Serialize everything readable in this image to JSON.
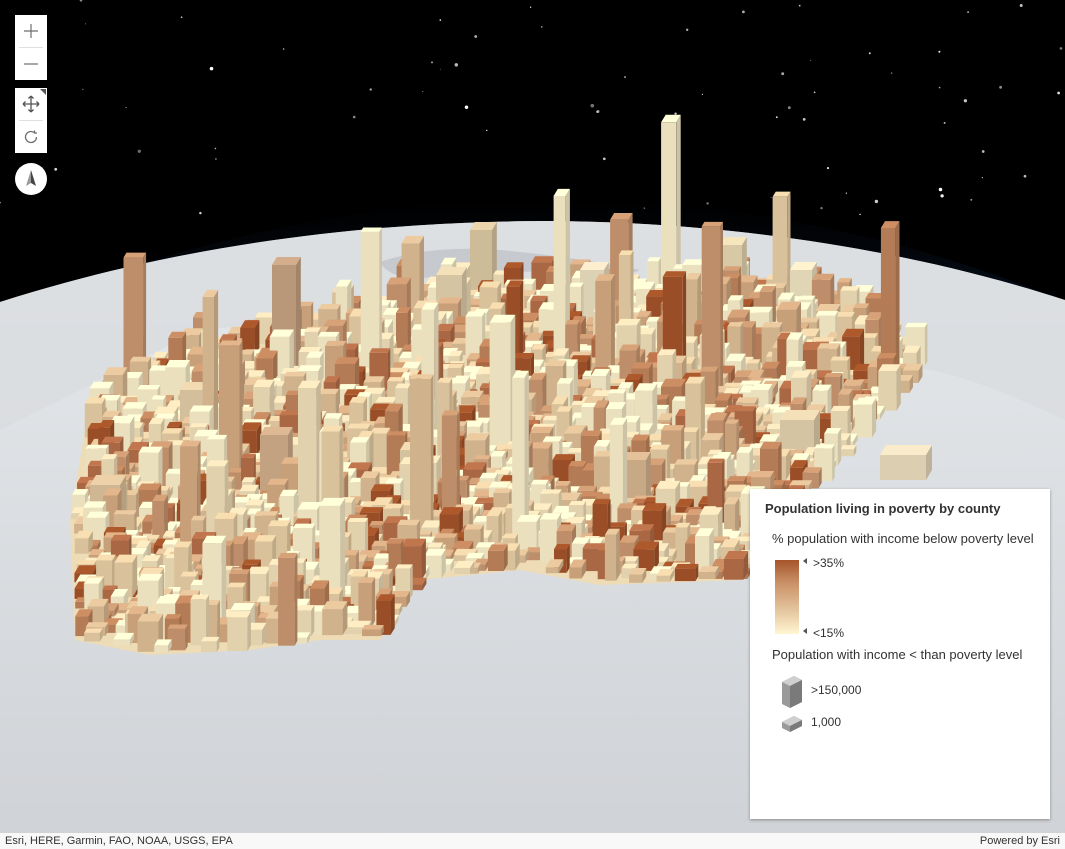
{
  "map": {
    "zoom_in_icon": "plus-icon",
    "zoom_out_icon": "minus-icon",
    "pan_icon": "pan-arrows-icon",
    "rotate_icon": "rotate-icon",
    "compass_icon": "compass-icon"
  },
  "legend": {
    "title": "Population living in poverty by county",
    "color_section": {
      "label": "% population with income below poverty level",
      "max_label": ">35%",
      "min_label": "<15%",
      "colors": [
        "#a6552a",
        "#fff6d2"
      ]
    },
    "size_section": {
      "label": "Population with income < than poverty level",
      "max_label": ">150,000",
      "min_label": "1,000"
    }
  },
  "attribution": {
    "sources": "Esri, HERE, Garmin, FAO, NOAA, USGS, EPA",
    "powered_by": "Powered by Esri"
  }
}
